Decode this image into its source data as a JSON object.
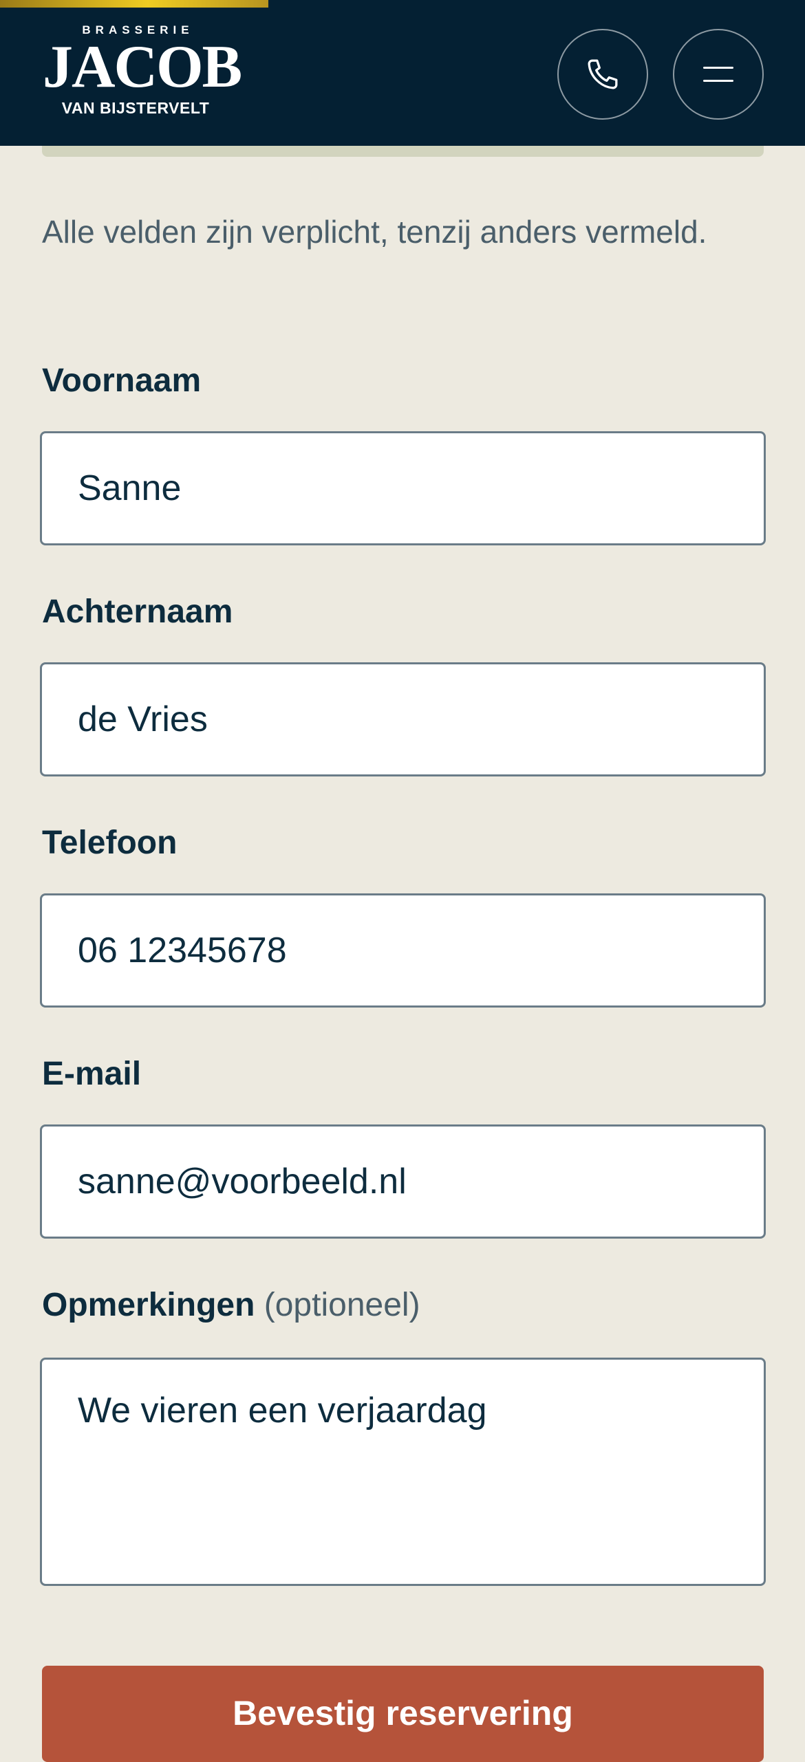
{
  "header": {
    "logo": {
      "top_text": "BRASSERIE",
      "main_text": "JACOB",
      "bottom_text": "VAN BIJSTERVELT"
    },
    "phone_icon": "phone-icon",
    "menu_icon": "hamburger-menu-icon",
    "background_color": "#042033",
    "progress_color": "#f0cc22"
  },
  "form": {
    "intro": "Alle velden zijn verplicht, tenzij anders vermeld.",
    "fields": [
      {
        "label": "Voornaam",
        "value": "Sanne"
      },
      {
        "label": "Achternaam",
        "value": "de Vries"
      },
      {
        "label": "Telefoon",
        "value": "06 12345678"
      },
      {
        "label": "E-mail",
        "value": "sanne@voorbeeld.nl"
      }
    ],
    "remarks": {
      "label": "Opmerkingen",
      "optional": "(optioneel)",
      "value": "We vieren een verjaardag"
    },
    "submit_label": "Bevestig reservering",
    "submit_color": "#b5533a"
  }
}
